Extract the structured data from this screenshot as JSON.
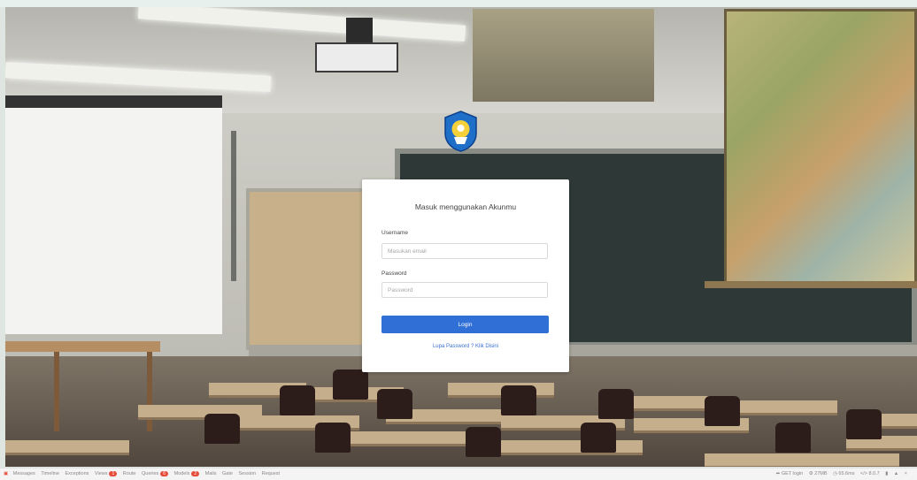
{
  "login": {
    "title": "Masuk menggunakan Akunmu",
    "username_label": "Username",
    "username_placeholder": "Masukan email",
    "password_label": "Password",
    "password_placeholder": "Password",
    "submit_label": "Login",
    "forgot_link": "Lupa Password ? Klik Disini"
  },
  "debugbar": {
    "items": [
      {
        "label": "Messages"
      },
      {
        "label": "Timeline"
      },
      {
        "label": "Exceptions"
      },
      {
        "label": "Views",
        "badge": "1"
      },
      {
        "label": "Route"
      },
      {
        "label": "Queries",
        "badge": "6"
      },
      {
        "label": "Models",
        "badge": "2"
      },
      {
        "label": "Mails"
      },
      {
        "label": "Gate"
      },
      {
        "label": "Session"
      },
      {
        "label": "Request"
      }
    ],
    "right": [
      "GET login",
      "27MB",
      "65.6ms",
      "8.0.7"
    ]
  },
  "colors": {
    "primary_button": "#2f6fd6",
    "link": "#3a6fd1",
    "badge": "#e74c3c"
  },
  "icons": {
    "logo": "tut-wuri-handayani-logo",
    "debugbar_logo": "laravel-debugbar-icon"
  }
}
